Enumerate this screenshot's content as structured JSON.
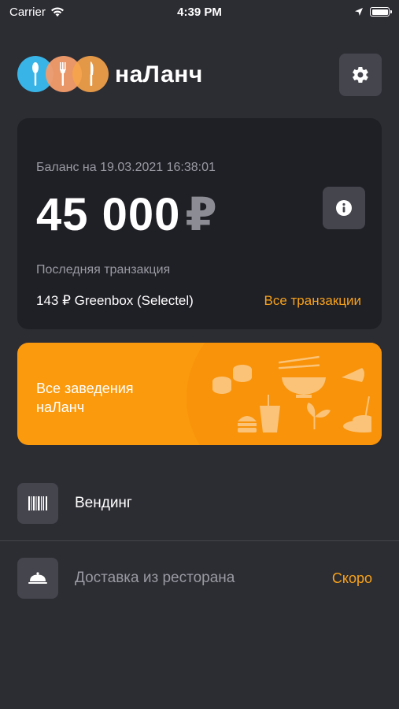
{
  "status_bar": {
    "carrier": "Carrier",
    "time": "4:39 PM"
  },
  "header": {
    "logo_text": "наЛанч",
    "settings_icon": "gear-icon"
  },
  "balance": {
    "label": "Баланс на 19.03.2021 16:38:01",
    "amount": "45 000",
    "currency": "₽",
    "info_icon": "info-icon",
    "last_transaction_label": "Последняя транзакция",
    "last_transaction": "143 ₽ Greenbox (Selectel)",
    "all_transactions_link": "Все транзакции"
  },
  "banner": {
    "line1": "Все заведения",
    "line2": "наЛанч"
  },
  "menu": {
    "vending_label": "Вендинг",
    "delivery_label": "Доставка из ресторана",
    "delivery_status": "Скоро"
  },
  "colors": {
    "accent": "#f7a21b",
    "banner": "#fb9a0d",
    "background": "#2c2c33",
    "card": "#1f1f26"
  }
}
